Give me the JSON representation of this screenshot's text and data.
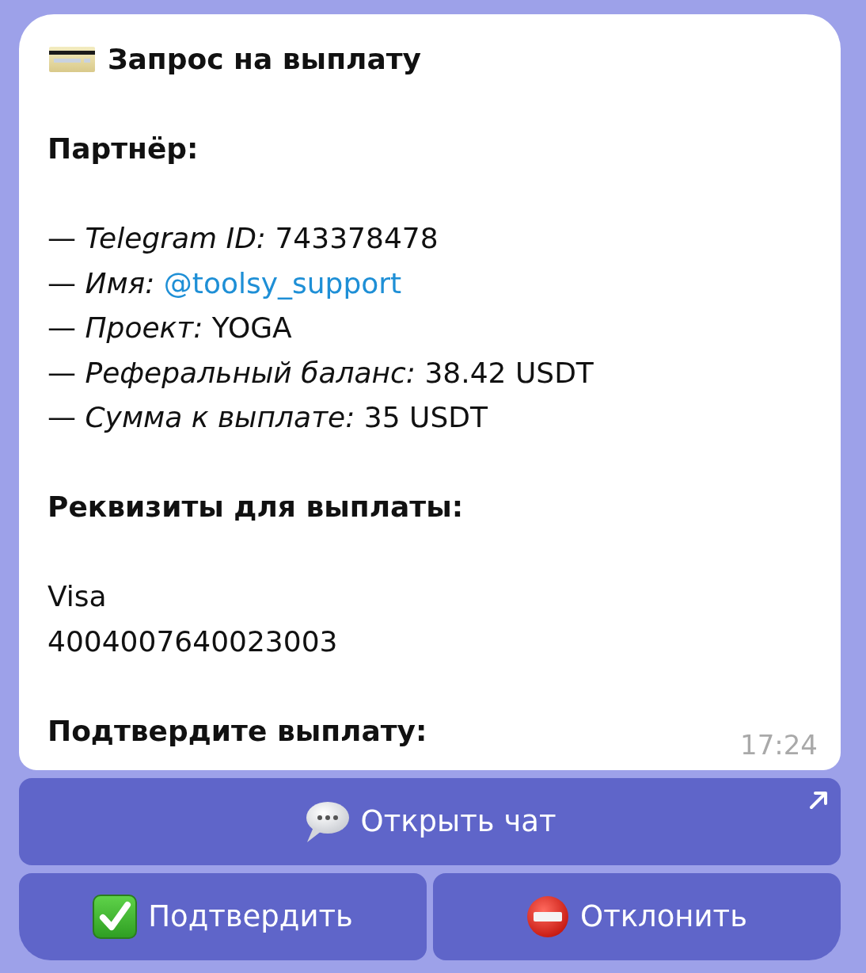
{
  "message": {
    "title": "Запрос на выплату",
    "sections": [
      {
        "heading": "Партнёр:",
        "lines": [
          {
            "kind": "text",
            "label": "— *Telegram ID:*",
            "value": "743378478"
          },
          {
            "kind": "link",
            "label": "— *Имя:*",
            "value": "@toolsy_support"
          },
          {
            "kind": "text",
            "label": "— *Проект:*",
            "value": "YOGA"
          },
          {
            "kind": "text",
            "label": "— *Реферальный баланс:*",
            "value": "38.42 USDT"
          },
          {
            "kind": "text",
            "label": "— *Сумма к выплате:*",
            "value": "35 USDT"
          }
        ]
      },
      {
        "heading": "Реквизиты для выплаты:",
        "lines": [
          {
            "kind": "text",
            "value": "Visa"
          },
          {
            "kind": "text",
            "value": "4004007640023003"
          }
        ]
      },
      {
        "heading": "Подтвердите выплату:"
      }
    ],
    "time": "17:24"
  },
  "keyboard": {
    "rows": [
      [
        {
          "label": "Открыть чат",
          "kind": "chat",
          "external": true
        }
      ],
      [
        {
          "label": "Подтвердить",
          "kind": "confirm",
          "external": false
        },
        {
          "label": "Отклонить",
          "kind": "decline",
          "external": false
        }
      ]
    ]
  }
}
